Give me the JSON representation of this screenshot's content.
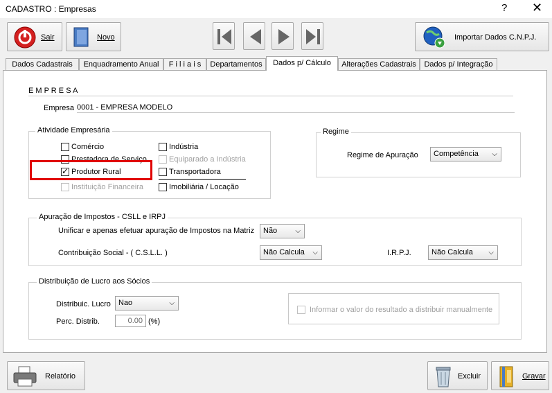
{
  "window": {
    "title": "CADASTRO : Empresas",
    "help_glyph": "?",
    "close_glyph": "✕"
  },
  "toolbar": {
    "sair_label": "Sair",
    "novo_label": "Novo",
    "import_label": "Importar Dados C.N.P.J."
  },
  "tabs": [
    {
      "label": "Dados  Cadastrais"
    },
    {
      "label": "Enquadramento Anual"
    },
    {
      "label": "F i l i a i s"
    },
    {
      "label": "Departamentos"
    },
    {
      "label": "Dados p/ Cálculo"
    },
    {
      "label": "Alterações Cadastrais"
    },
    {
      "label": "Dados p/ Integração"
    }
  ],
  "empresa": {
    "group_title": "E M P R E S A",
    "label": "Empresa",
    "value": "0001 - EMPRESA MODELO"
  },
  "atividade": {
    "group_title": "Atividade Empresária",
    "items": [
      {
        "label": "Comércio",
        "checked": false,
        "enabled": true
      },
      {
        "label": "Prestadora de Serviço",
        "checked": false,
        "enabled": true
      },
      {
        "label": "Produtor Rural",
        "checked": true,
        "enabled": true
      },
      {
        "label": "Instituição Financeira",
        "checked": false,
        "enabled": false
      },
      {
        "label": "Indústria",
        "checked": false,
        "enabled": true
      },
      {
        "label": "Equiparado a Indústria",
        "checked": false,
        "enabled": false
      },
      {
        "label": "Transportadora",
        "checked": false,
        "enabled": true
      },
      {
        "label": "Imobiliária / Locação",
        "checked": false,
        "enabled": true
      }
    ],
    "check_glyph": "✓"
  },
  "regime": {
    "group_title": "Regime",
    "label": "Regime de Apuração",
    "value": "Competência"
  },
  "apuracao": {
    "group_title": "Apuração de Impostos - CSLL e IRPJ",
    "unificar_label": "Unificar e apenas efetuar apuração de Impostos na Matriz",
    "unificar_value": "Não",
    "csll_label": "Contribuição Social - ( C.S.L.L. )",
    "csll_value": "Não Calcula",
    "irpj_label": "I.R.P.J.",
    "irpj_value": "Não Calcula"
  },
  "distribuicao": {
    "group_title": "Distribuição de Lucro aos Sócios",
    "lucro_label": "Distribuic. Lucro",
    "lucro_value": "Nao",
    "perc_label": "Perc. Distrib.",
    "perc_value": "0.00",
    "perc_suffix": "(%)",
    "manual_label": "Informar o valor do resultado a distribuir manualmente"
  },
  "footer": {
    "relatorio_label": "Relatório",
    "excluir_label": "Excluir",
    "gravar_label": "Gravar"
  },
  "dropdown_glyph": "⌵",
  "colors": {
    "highlight": "#e00000",
    "sair_red": "#d42020",
    "globe_blue": "#2060c0",
    "accent_green": "#3aa040"
  }
}
